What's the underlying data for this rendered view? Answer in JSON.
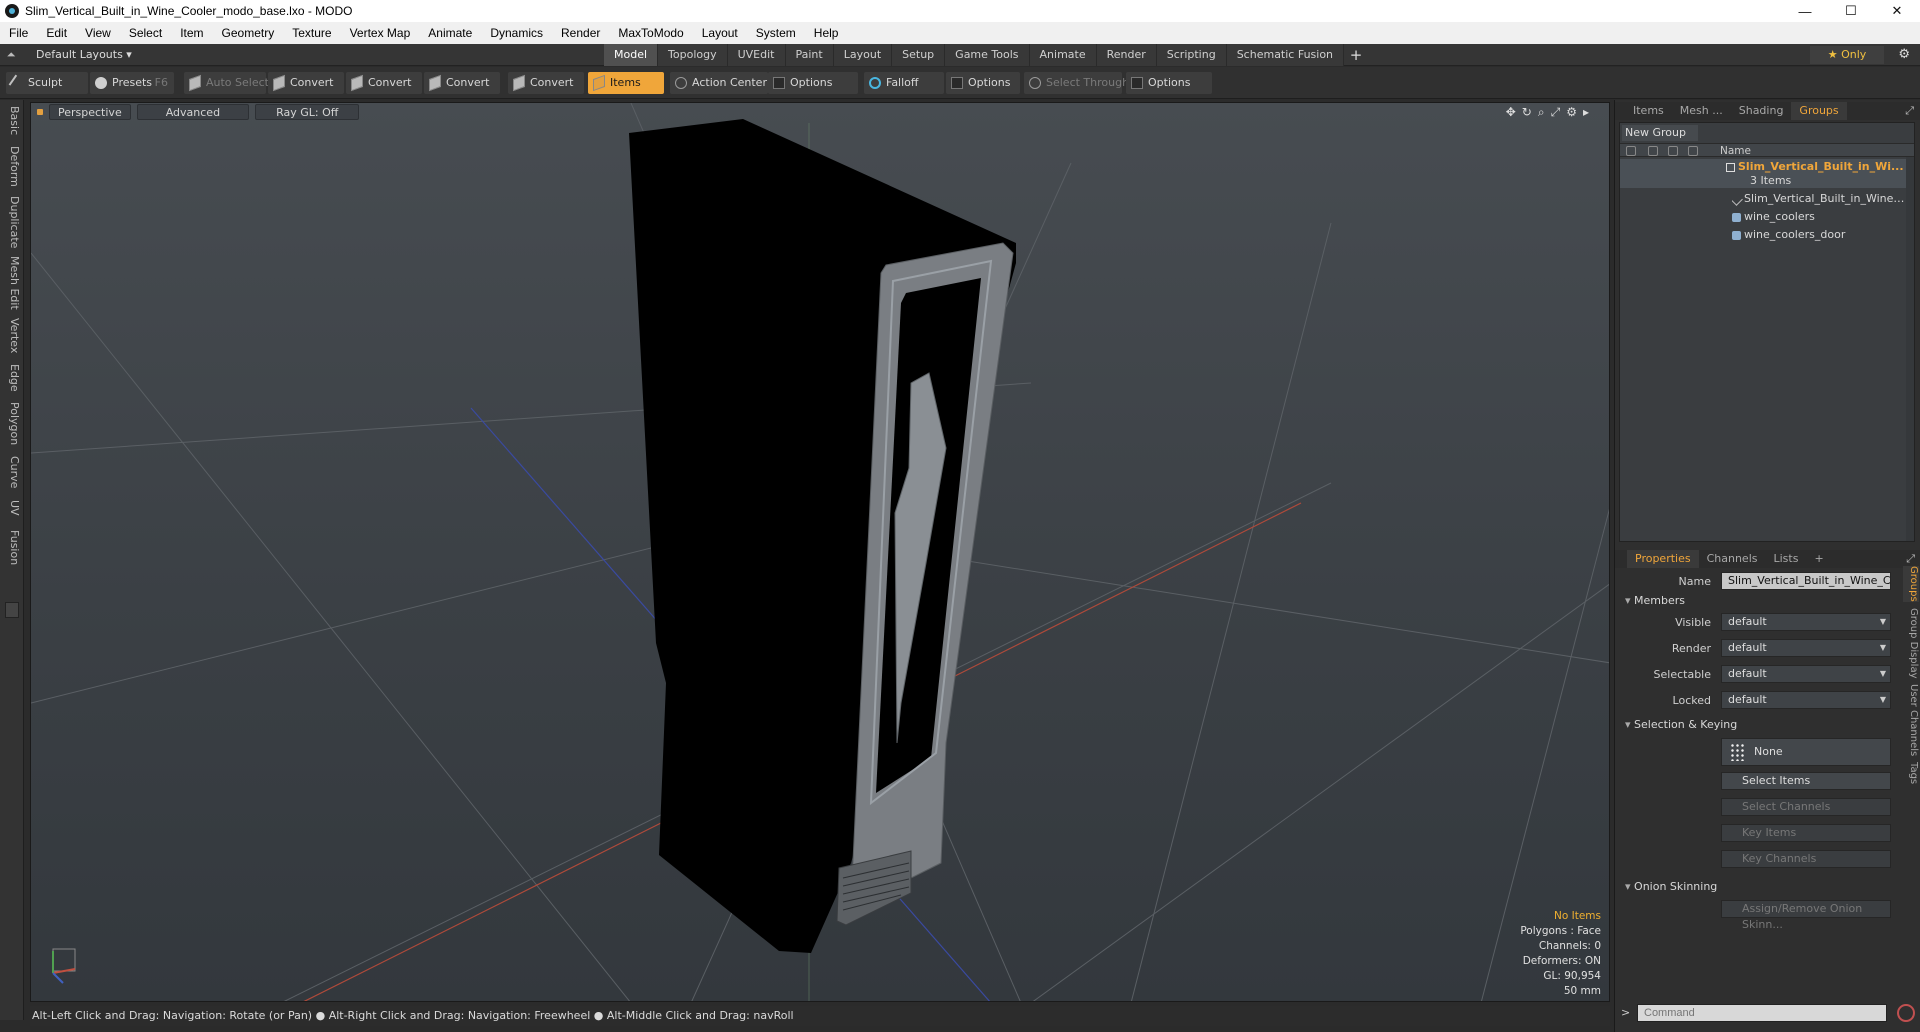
{
  "window": {
    "title": "Slim_Vertical_Built_in_Wine_Cooler_modo_base.lxo - MODO",
    "controls": {
      "minimize": "—",
      "maximize": "☐",
      "close": "✕"
    }
  },
  "menu": [
    "File",
    "Edit",
    "View",
    "Select",
    "Item",
    "Geometry",
    "Texture",
    "Vertex Map",
    "Animate",
    "Dynamics",
    "Render",
    "MaxToModo",
    "Layout",
    "System",
    "Help"
  ],
  "layout": {
    "selector": "Default Layouts ▾",
    "tabs": [
      "Model",
      "Topology",
      "UVEdit",
      "Paint",
      "Layout",
      "Setup",
      "Game Tools",
      "Animate",
      "Render",
      "Scripting",
      "Schematic Fusion"
    ],
    "active_tab": "Model",
    "add_tab": "+",
    "only": "★  Only",
    "gear": "⚙"
  },
  "toolbar": {
    "sculpt": "Sculpt",
    "presets": "Presets",
    "presets_key": "F6",
    "auto_select": "Auto Select",
    "convert1": "Convert",
    "convert2": "Convert",
    "convert3": "Convert",
    "convert4": "Convert",
    "items": "Items",
    "action_center": "Action Center",
    "options1": "Options",
    "falloff": "Falloff",
    "options2": "Options",
    "select_through": "Select Through",
    "options3": "Options"
  },
  "left_tabs": [
    "Basic",
    "Deform",
    "Duplicate",
    "Mesh Edit",
    "Vertex",
    "Edge",
    "Polygon",
    "Curve",
    "UV",
    "Fusion"
  ],
  "viewport": {
    "perspective": "Perspective",
    "advanced": "Advanced",
    "raygl": "Ray GL: Off",
    "icons": [
      "✥",
      "↻",
      "⌕",
      "⤢",
      "⚙",
      "▸"
    ],
    "info": {
      "no_items": "No Items",
      "polygons": "Polygons : Face",
      "channels": "Channels: 0",
      "deformers": "Deformers: ON",
      "gl": "GL: 90,954",
      "scale": "50 mm"
    }
  },
  "status": "Alt-Left Click and Drag: Navigation: Rotate (or Pan) ● Alt-Right Click and Drag: Navigation: Freewheel ● Alt-Middle Click and Drag: navRoll",
  "groups_panel": {
    "tabs": [
      "Items",
      "Mesh ...",
      "Shading",
      "Groups"
    ],
    "active_tab": "Groups",
    "new_group": "New Group",
    "name_header": "Name",
    "group_name": "Slim_Vertical_Built_in_Wi...",
    "group_count": "3 Items",
    "items": [
      "Slim_Vertical_Built_in_Wine_...",
      "wine_coolers",
      "wine_coolers_door"
    ]
  },
  "properties": {
    "tabs": [
      "Properties",
      "Channels",
      "Lists"
    ],
    "active_tab": "Properties",
    "add": "+",
    "name_label": "Name",
    "name_value": "Slim_Vertical_Built_in_Wine_Coole",
    "members": "Members",
    "visible_label": "Visible",
    "visible": "default",
    "render_label": "Render",
    "render": "default",
    "selectable_label": "Selectable",
    "selectable": "default",
    "locked_label": "Locked",
    "locked": "default",
    "selection_keying": "Selection & Keying",
    "none": "None",
    "select_items": "Select Items",
    "select_channels": "Select Channels",
    "key_items": "Key Items",
    "key_channels": "Key Channels",
    "onion_skinning": "Onion Skinning",
    "assign_onion": "Assign/Remove Onion Skinn...",
    "side_tabs": [
      "Groups",
      "Group Display",
      "User Channels",
      "Tags"
    ]
  },
  "command": {
    "placeholder": "Command",
    "prompt": ">"
  }
}
